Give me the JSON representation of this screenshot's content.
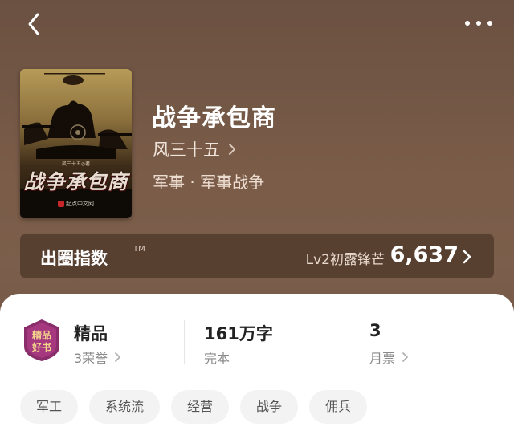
{
  "book": {
    "title": "战争承包商",
    "author": "风三十五",
    "category": "军事 · 军事战争",
    "cover": {
      "title": "战争承包商",
      "author_line": "风三十五◎著",
      "publisher": "起点中文网"
    }
  },
  "index": {
    "label": "出圈指数",
    "tm": "TM",
    "level": "Lv2初露锋芒",
    "value": "6,637"
  },
  "stats": {
    "quality": {
      "title": "精品",
      "sub": "3荣誉"
    },
    "words": {
      "title": "161万字",
      "sub": "完本"
    },
    "tickets": {
      "title": "3",
      "sub": "月票"
    }
  },
  "badge": {
    "text": "精品好书"
  },
  "tags": [
    "军工",
    "系统流",
    "经营",
    "战争",
    "佣兵"
  ],
  "colors": {
    "header_bg": "#755948",
    "badge_purple": "#8a2d6b",
    "badge_gold": "#e6c27a"
  }
}
